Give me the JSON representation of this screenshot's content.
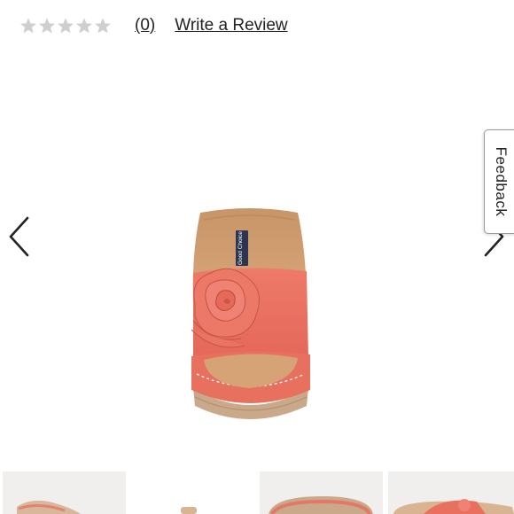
{
  "rating": {
    "stars_filled": 0,
    "stars_total": 5,
    "review_count_label": "(0)",
    "write_review_label": "Write a Review"
  },
  "feedback": {
    "label": "Feedback"
  },
  "product_image": {
    "brand_label": "Good Choice",
    "color": "#e9705f"
  },
  "colors": {
    "star_empty": "#cfcfcf",
    "thumb_bg": "#f0efed",
    "sole": "#c9a98a"
  }
}
